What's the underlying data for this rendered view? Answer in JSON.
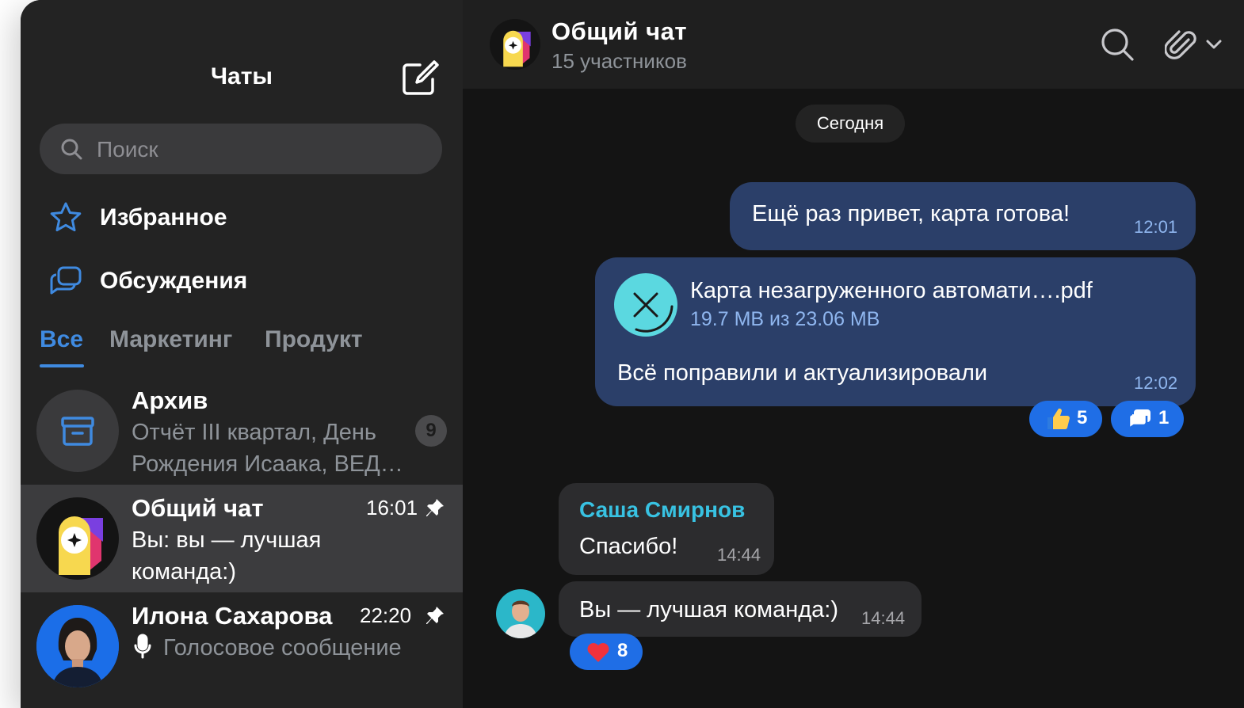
{
  "sidebar": {
    "title": "Чаты",
    "search_placeholder": "Поиск",
    "nav": [
      {
        "label": "Избранное",
        "icon": "star-icon"
      },
      {
        "label": "Обсуждения",
        "icon": "discussions-icon"
      }
    ],
    "tabs": [
      "Все",
      "Маркетинг",
      "Продукт"
    ],
    "active_tab": "Все",
    "chats": [
      {
        "name": "Архив",
        "preview_line1": "Отчёт III квартал, День",
        "preview_line2": "Рождения Исаака, ВЕД…",
        "badge": "9"
      },
      {
        "name": "Общий чат",
        "time": "16:01",
        "preview_line1": "Вы: вы — лучшая",
        "preview_line2": "команда:)",
        "pinned": true
      },
      {
        "name": "Илона Сахарова",
        "time": "22:20",
        "preview": "Голосовое сообщение",
        "pinned": true
      }
    ]
  },
  "header": {
    "title": "Общий чат",
    "subtitle": "15 участников"
  },
  "messages": {
    "date_label": "Сегодня",
    "out1": {
      "text": "Ещё раз привет, карта готова!",
      "time": "12:01"
    },
    "out2": {
      "file_name": "Карта незагруженного автомати….pdf",
      "file_progress": "19.7 MB из 23.06 MB",
      "text": "Всё поправили и актуализировали",
      "time": "12:02",
      "reactions": [
        {
          "emoji": "thumbs-up",
          "count": "5"
        },
        {
          "emoji": "thread-icon",
          "count": "1"
        }
      ]
    },
    "in1": {
      "sender": "Саша Смирнов",
      "text": "Спасибо!",
      "time": "14:44"
    },
    "in2": {
      "text": "Вы — лучшая команда:)",
      "time": "14:44",
      "reactions": [
        {
          "emoji": "heart",
          "count": "8"
        }
      ]
    }
  },
  "colors": {
    "accent": "#3f8ae0",
    "outgoing_bubble": "#2b3f69",
    "incoming_bubble": "#2c2c2e",
    "reaction": "#1f6ee6",
    "sender_name": "#38c2e2"
  }
}
